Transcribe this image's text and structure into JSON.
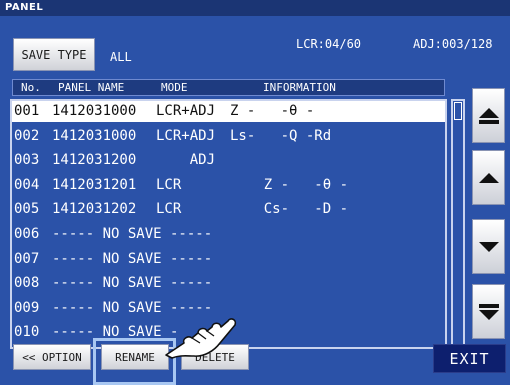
{
  "window": {
    "title": "PANEL"
  },
  "toolbar": {
    "save_type_label": "SAVE TYPE",
    "save_type_value": "ALL",
    "lcr_count": "LCR:04/60",
    "adj_count": "ADJ:003/128"
  },
  "table": {
    "headers": [
      "No.",
      "PANEL NAME",
      "MODE",
      "INFORMATION"
    ],
    "rows": [
      {
        "no": "001",
        "name": "1412031000",
        "mode": "LCR+ADJ",
        "info": "Z -   -θ -",
        "selected": true
      },
      {
        "no": "002",
        "name": "1412031000",
        "mode": "LCR+ADJ",
        "info": "Ls-   -Q -Rd"
      },
      {
        "no": "003",
        "name": "1412031200",
        "mode": "    ADJ",
        "info": ""
      },
      {
        "no": "004",
        "name": "1412031201",
        "mode": "LCR",
        "info": "    Z -   -θ -"
      },
      {
        "no": "005",
        "name": "1412031202",
        "mode": "LCR",
        "info": "    Cs-   -D -"
      },
      {
        "no": "006",
        "name": "----- NO SAVE -----",
        "mode": "",
        "info": ""
      },
      {
        "no": "007",
        "name": "----- NO SAVE -----",
        "mode": "",
        "info": ""
      },
      {
        "no": "008",
        "name": "----- NO SAVE -----",
        "mode": "",
        "info": ""
      },
      {
        "no": "009",
        "name": "----- NO SAVE -----",
        "mode": "",
        "info": ""
      },
      {
        "no": "010",
        "name": "----- NO SAVE -",
        "mode": "",
        "info": ""
      }
    ]
  },
  "nav": {
    "page_up_icon": "double-up-arrow-icon",
    "up_icon": "up-arrow-icon",
    "down_icon": "down-arrow-icon",
    "page_down_icon": "double-down-arrow-icon"
  },
  "bottom_bar": {
    "option_label": "<< OPTION",
    "rename_label": "RENAME",
    "delete_label": "DELETE",
    "exit_label": "EXIT"
  }
}
